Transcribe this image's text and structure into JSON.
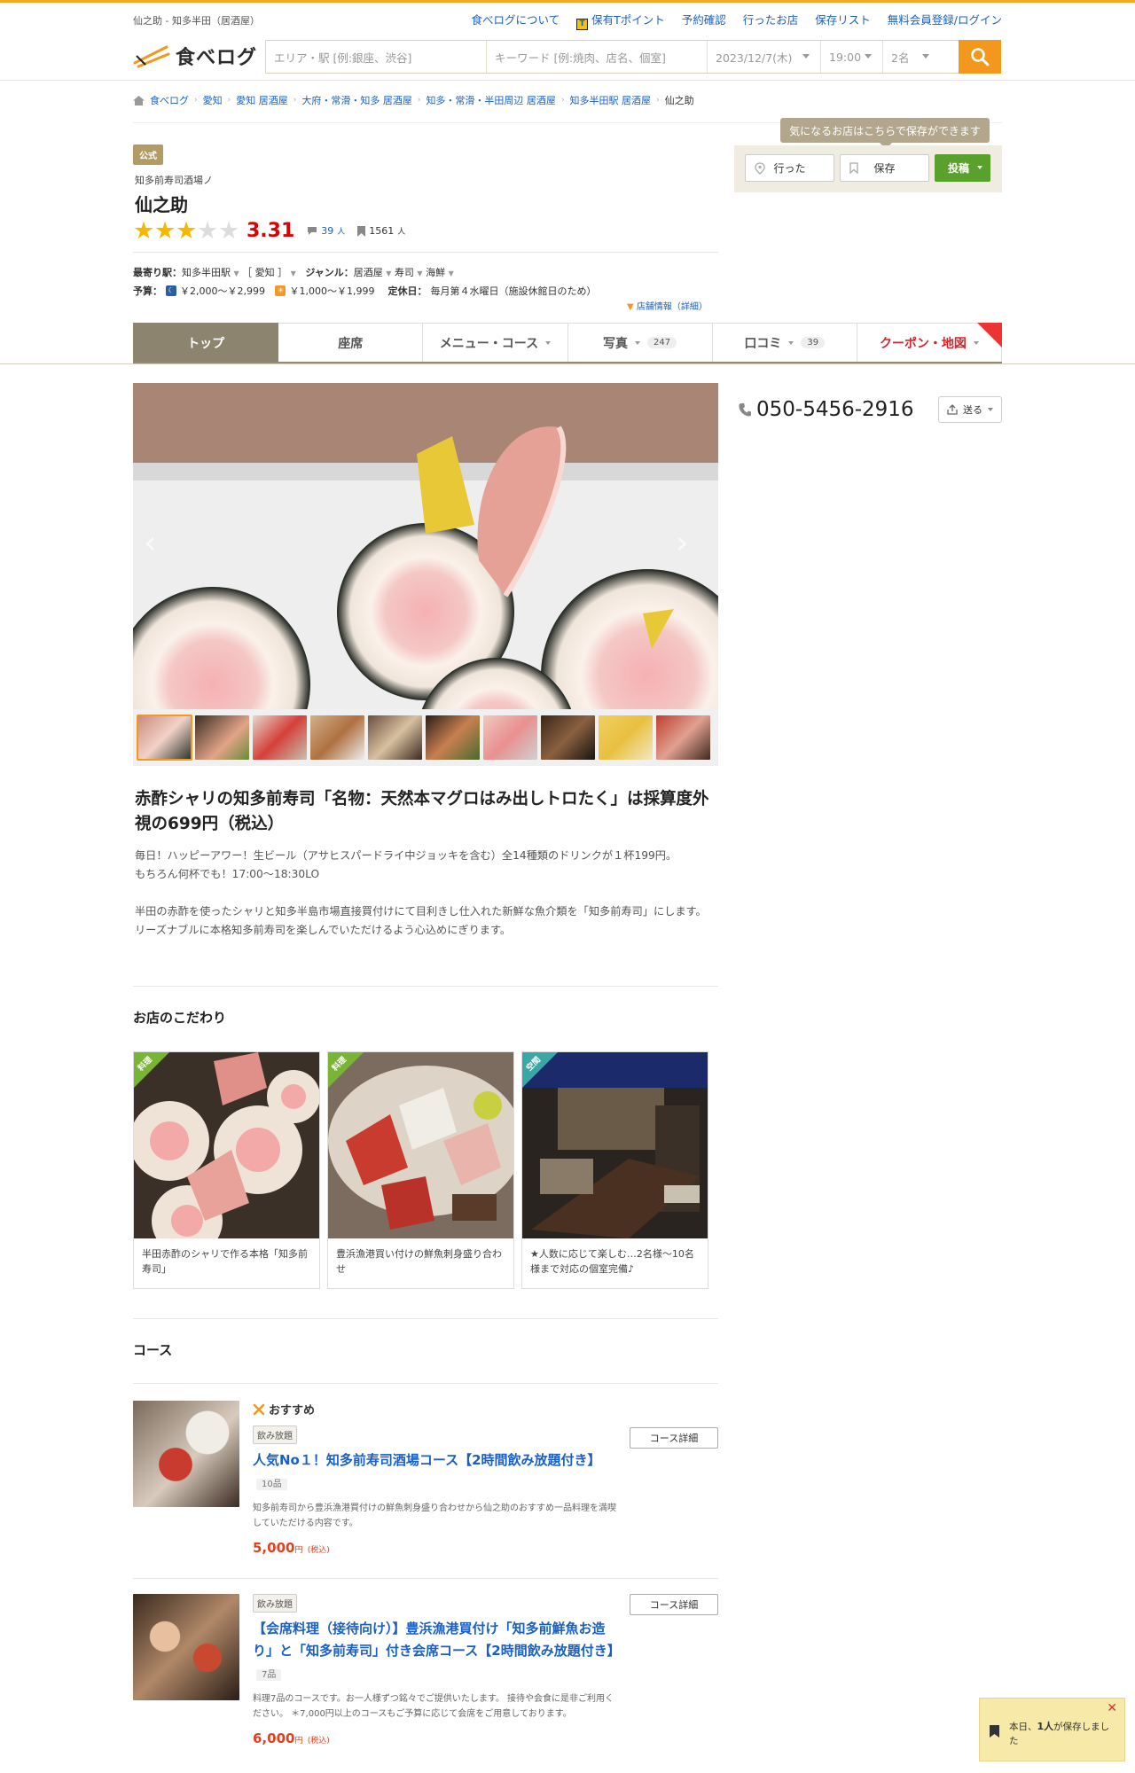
{
  "header": {
    "site_label": "仙之助 - 知多半田（居酒屋）",
    "links": [
      "食べログについて",
      "保有Tポイント",
      "予約確認",
      "行ったお店",
      "保存リスト",
      "無料会員登録/ログイン"
    ],
    "logo_text": "食べログ",
    "search": {
      "area_placeholder": "エリア・駅 [例:銀座、渋谷]",
      "keyword_placeholder": "キーワード [例:焼肉、店名、個室]",
      "date": "2023/12/7(木)",
      "time": "19:00",
      "people": "2名"
    }
  },
  "breadcrumb": [
    "食べログ",
    "愛知",
    "愛知 居酒屋",
    "大府・常滑・知多 居酒屋",
    "知多・常滑・半田周辺 居酒屋",
    "知多半田駅 居酒屋",
    "仙之助"
  ],
  "restaurant": {
    "official_badge": "公式",
    "subname": "知多前寿司酒場ノ",
    "name": "仙之助",
    "stars_filled": 3,
    "score": "3.31",
    "reviews": "39",
    "reviews_unit": "人",
    "saves": "1561",
    "saves_unit": "人",
    "station_label": "最寄り駅：",
    "station": "知多半田駅",
    "pref": "［ 愛知 ］",
    "genre_label": "ジャンル：",
    "genres": [
      "居酒屋",
      "寿司",
      "海鮮"
    ],
    "budget_label": "予算：",
    "budget_dinner": "￥2,000～￥2,999",
    "budget_lunch": "￥1,000～￥1,999",
    "holiday_label": "定休日：",
    "holiday": "毎月第４水曜日（施設休館日のため）",
    "detail_link": "店舗情報（詳細）"
  },
  "save_panel": {
    "tip": "気になるお店はこちらで保存ができます",
    "went": "行った",
    "keep": "保存",
    "post": "投稿"
  },
  "tabs": [
    {
      "label": "トップ",
      "badge": ""
    },
    {
      "label": "座席",
      "badge": ""
    },
    {
      "label": "メニュー・コース",
      "badge": ""
    },
    {
      "label": "写真",
      "badge": "247"
    },
    {
      "label": "口コミ",
      "badge": "39"
    },
    {
      "label": "クーポン・地図",
      "badge": ""
    }
  ],
  "phone": "050-5456-2916",
  "send_label": "送る",
  "headline": "赤酢シャリの知多前寿司「名物：天然本マグロはみ出しトロたく」は採算度外視の699円（税込）",
  "description": [
    "毎日！ハッピーアワー！生ビール（アサヒスパードライ中ジョッキを含む）全14種類のドリンクが１杯199円。",
    "もちろん何杯でも！17:00～18:30LO",
    "半田の赤酢を使ったシャリと知多半島市場直接買付けにて目利きし仕入れた新鮮な魚介類を「知多前寿司」にします。",
    "リーズナブルに本格知多前寿司を楽しんでいただけるよう心込めにぎります。"
  ],
  "kodawari": {
    "title": "お店のこだわり",
    "items": [
      {
        "tag": "料理",
        "caption": "半田赤酢のシャリで作る本格「知多前寿司」"
      },
      {
        "tag": "料理",
        "caption": "豊浜漁港買い付けの鮮魚刺身盛り合わせ"
      },
      {
        "tag": "空間",
        "caption": "★人数に応じて楽しむ…2名様〜10名様まで対応の個室完備♪"
      }
    ]
  },
  "courses": {
    "title": "コース",
    "recommend": "おすすめ",
    "detail_button": "コース詳細",
    "items": [
      {
        "tag": "飲み放題",
        "title": "人気No１！知多前寿司酒場コース【2時間飲み放題付き】",
        "count": "10品",
        "desc": "知多前寿司から豊浜漁港買付けの鮮魚刺身盛り合わせから仙之助のおすすめ一品料理を満喫していただける内容です。",
        "price": "5,000",
        "unit": "円",
        "tax": "(税込)"
      },
      {
        "tag": "飲み放題",
        "title": "【会席料理（接待向け）】豊浜漁港買付け「知多前鮮魚お造り」と「知多前寿司」付き会席コース【2時間飲み放題付き】",
        "count": "7品",
        "desc": "料理7品のコースです。お一人様ずつ銘々でご提供いたします。 接待や会食に是非ご利用ください。 ＊7,000円以上のコースもご予算に応じて会席をご用意しております。",
        "price": "6,000",
        "unit": "円",
        "tax": "(税込)"
      }
    ]
  },
  "notice": {
    "prefix": "本日、",
    "count": "1人",
    "suffix": "が保存しました"
  }
}
